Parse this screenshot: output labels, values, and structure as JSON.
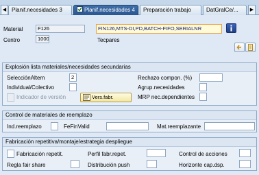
{
  "tabs": [
    {
      "label": "Planif.necesidades 3"
    },
    {
      "label": "Planif.necesidades 4",
      "active": true
    },
    {
      "label": "Preparación trabajo"
    },
    {
      "label": "DatGralCe/..."
    }
  ],
  "header": {
    "material_label": "Material",
    "material_value": "F126",
    "material_desc": "FIN126,MTS-DI,PD,BATCH-FIFO,SERIALNR",
    "centro_label": "Centro",
    "centro_value": "1000",
    "centro_desc": "Tecpares"
  },
  "explosion": {
    "title": "Explosión lista materiales/necesidades secundarias",
    "seleccion_label": "SelecciónAltern",
    "seleccion_value": "2",
    "individual_label": "Individual/Colectivo",
    "indicador_label": "Indicador de versión",
    "vers_button": "Vers.fabr.",
    "rechazo_label": "Rechazo compon. (%)",
    "agrup_label": "Agrup.necesidades",
    "mrp_label": "MRP nec.dependientes"
  },
  "reemplazo": {
    "title": "Control de materiales de reemplazo",
    "ind_label": "Ind.reemplazo",
    "fefin_label": "FeFinValid",
    "mat_label": "Mat.reemplazante"
  },
  "fabricacion": {
    "title": "Fabricación repetitiva/montaje/estrategia despliegue",
    "fab_label": "Fabricación repetit.",
    "perfil_label": "Perfil fabr.repet.",
    "control_label": "Control de acciones",
    "regla_label": "Regla fair share",
    "distrib_label": "Distribución push",
    "horizonte_label": "Horizonte cap.dsp."
  }
}
